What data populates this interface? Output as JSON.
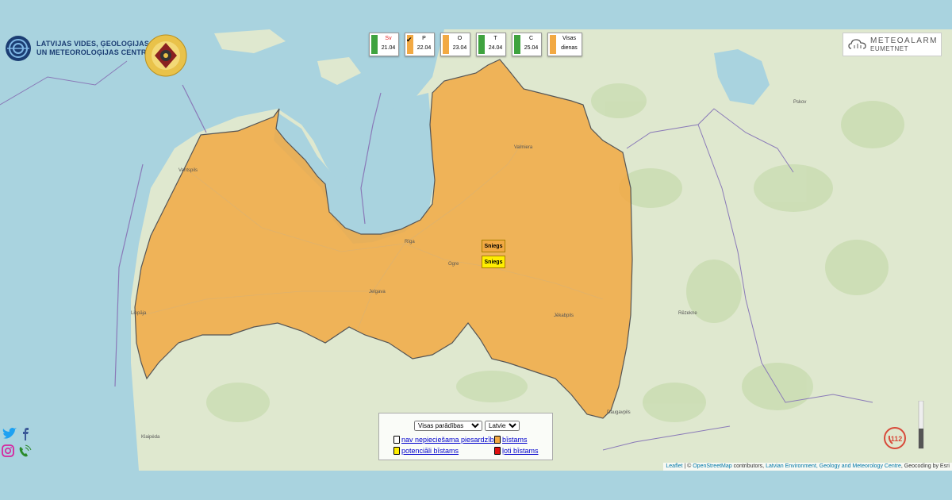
{
  "header": {
    "lvgmc_line1": "LATVIJAS VIDES, ĢEOLOĢIJAS",
    "lvgmc_line2": "UN METEOROLOĢIJAS CENTRS"
  },
  "days": [
    {
      "label": "Sv",
      "date": "21.04",
      "color": "#3fa33f",
      "label_color": "#e02020",
      "selected": false
    },
    {
      "label": "P",
      "date": "22.04",
      "color": "#f2a943",
      "label_color": "#000000",
      "selected": true
    },
    {
      "label": "O",
      "date": "23.04",
      "color": "#f2a943",
      "label_color": "#000000",
      "selected": false
    },
    {
      "label": "T",
      "date": "24.04",
      "color": "#3fa33f",
      "label_color": "#000000",
      "selected": false
    },
    {
      "label": "C",
      "date": "25.04",
      "color": "#3fa33f",
      "label_color": "#000000",
      "selected": false
    }
  ],
  "visas": {
    "line1": "Visas",
    "line2": "dienas",
    "color": "#f2a943"
  },
  "meteoalarm": {
    "brand": "METEOALARM",
    "sub": "EUMETNET"
  },
  "markers": [
    {
      "text": "Sniegs",
      "color": "#f2a943"
    },
    {
      "text": "Sniegs",
      "color": "#ffee00"
    }
  ],
  "legend": {
    "filter_selected": "Visas parādības",
    "language_selected": "Latviešu",
    "items": [
      {
        "text": "nav nepieciešama piesardzība",
        "color": "#ffffff"
      },
      {
        "text": "bīstams",
        "color": "#f2a943"
      },
      {
        "text": "potenciāli bīstams",
        "color": "#ffee00"
      },
      {
        "text": "ļoti bīstams",
        "color": "#e01010"
      }
    ]
  },
  "attribution": {
    "leaflet": "Leaflet",
    "sep1": " | © ",
    "osm": "OpenStreetMap",
    "contrib": " contributors, ",
    "env": "Latvian Environment, Geology and Meteorology Centre",
    "tail": ", Geocoding by Esri"
  },
  "cities": [
    "Rīga",
    "Ventspils",
    "Liepāja",
    "Jelgava",
    "Ogre",
    "Jēkabpils",
    "Valmiera",
    "Rēzekne",
    "Daugavpils",
    "Klaipėda",
    "Pskov"
  ],
  "badge": "112",
  "colors": {
    "warning_orange": "#f2a943",
    "sea": "#a9d3df",
    "land": "#dfe8cf"
  }
}
